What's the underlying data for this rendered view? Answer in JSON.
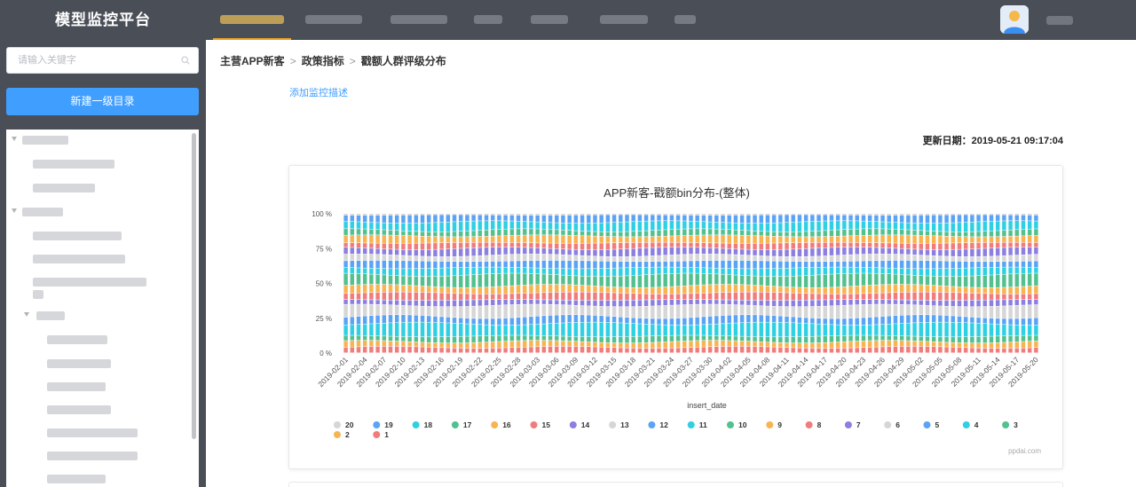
{
  "app": {
    "title": "模型监控平台"
  },
  "nav": {
    "items": [
      "",
      "",
      "",
      "",
      "",
      "",
      ""
    ]
  },
  "sidebar": {
    "search_placeholder": "请输入关键字",
    "new_button": "新建一级目录"
  },
  "breadcrumb": [
    "主营APP新客",
    "政策指标",
    "戳额人群评级分布"
  ],
  "add_desc_link": "添加监控描述",
  "update_label": "更新日期：2019-05-21 09:17:04",
  "watermark": "ppdai.com",
  "colors": {
    "20": "#d6d6d6",
    "19": "#5ba3f5",
    "18": "#2fd0e3",
    "17": "#52c18f",
    "16": "#f7b451",
    "15": "#f17c7c",
    "14": "#8d7fe0",
    "13": "#d6d6d6",
    "12": "#5ba3f5",
    "11": "#2fd0e3",
    "10": "#52c18f",
    "9": "#f7b451",
    "8": "#f17c7c",
    "7": "#8d7fe0",
    "6": "#d6d6d6",
    "5": "#5ba3f5",
    "4": "#2fd0e3",
    "3": "#52c18f",
    "2": "#f7b451",
    "1": "#f17c7c"
  },
  "chart_data": {
    "type": "bar",
    "title": "APP新客-戳额bin分布-(整体)",
    "xlabel": "insert_date",
    "ylabel": "",
    "stacked_percent": true,
    "ylim": [
      0,
      100
    ],
    "yticks": [
      "0 %",
      "25 %",
      "50 %",
      "75 %",
      "100 %"
    ],
    "x_tick_labels": [
      "2019-02-01",
      "2019-02-04",
      "2019-02-07",
      "2019-02-10",
      "2019-02-13",
      "2019-02-16",
      "2019-02-19",
      "2019-02-22",
      "2019-02-25",
      "2019-02-28",
      "2019-03-03",
      "2019-03-06",
      "2019-03-09",
      "2019-03-12",
      "2019-03-15",
      "2019-03-18",
      "2019-03-21",
      "2019-03-24",
      "2019-03-27",
      "2019-03-30",
      "2019-04-02",
      "2019-04-05",
      "2019-04-08",
      "2019-04-11",
      "2019-04-14",
      "2019-04-17",
      "2019-04-20",
      "2019-04-23",
      "2019-04-26",
      "2019-04-29",
      "2019-05-02",
      "2019-05-05",
      "2019-05-08",
      "2019-05-11",
      "2019-05-14",
      "2019-05-17",
      "2019-05-20"
    ],
    "legend": [
      "20",
      "19",
      "18",
      "17",
      "16",
      "15",
      "14",
      "13",
      "12",
      "11",
      "10",
      "9",
      "8",
      "7",
      "6",
      "5",
      "4",
      "3",
      "2",
      "1"
    ],
    "stack_order_bottom_to_top": [
      "1",
      "2",
      "3",
      "4",
      "5",
      "6",
      "7",
      "8",
      "9",
      "10",
      "11",
      "12",
      "13",
      "14",
      "15",
      "16",
      "17",
      "18",
      "19",
      "20"
    ],
    "bin_share_typical": [
      4,
      4,
      4,
      9,
      5,
      8,
      4,
      5,
      5,
      8,
      5,
      5,
      4,
      5,
      4,
      5,
      4,
      6,
      5,
      1
    ]
  }
}
